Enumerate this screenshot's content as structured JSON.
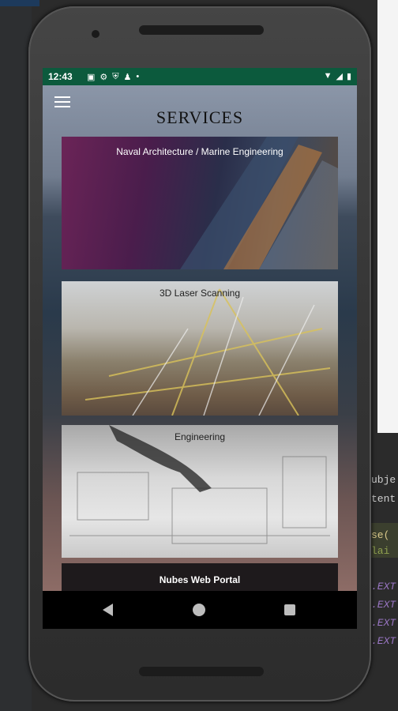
{
  "status_bar": {
    "time": "12:43",
    "left_icons": [
      "image-icon",
      "settings-icon",
      "shield-icon",
      "person-icon",
      "dot-icon"
    ],
    "right_icons": [
      "wifi-icon",
      "signal-icon",
      "battery-icon"
    ]
  },
  "app": {
    "title": "SERVICES",
    "services": [
      {
        "label": "Naval Architecture / Marine Engineering"
      },
      {
        "label": "3D Laser Scanning"
      },
      {
        "label": "Engineering"
      },
      {
        "label": "Nubes Web Portal"
      }
    ]
  },
  "ide_fragments": {
    "line1": "ubje",
    "line2": "tent",
    "line3": "se(",
    "line4": "lai",
    "line5": ".EXT",
    "line6": ".EXT",
    "line7": ".EXT",
    "line8": ".EXT"
  },
  "colors": {
    "status_bar": "#0c5a3d",
    "title": "#111111"
  }
}
